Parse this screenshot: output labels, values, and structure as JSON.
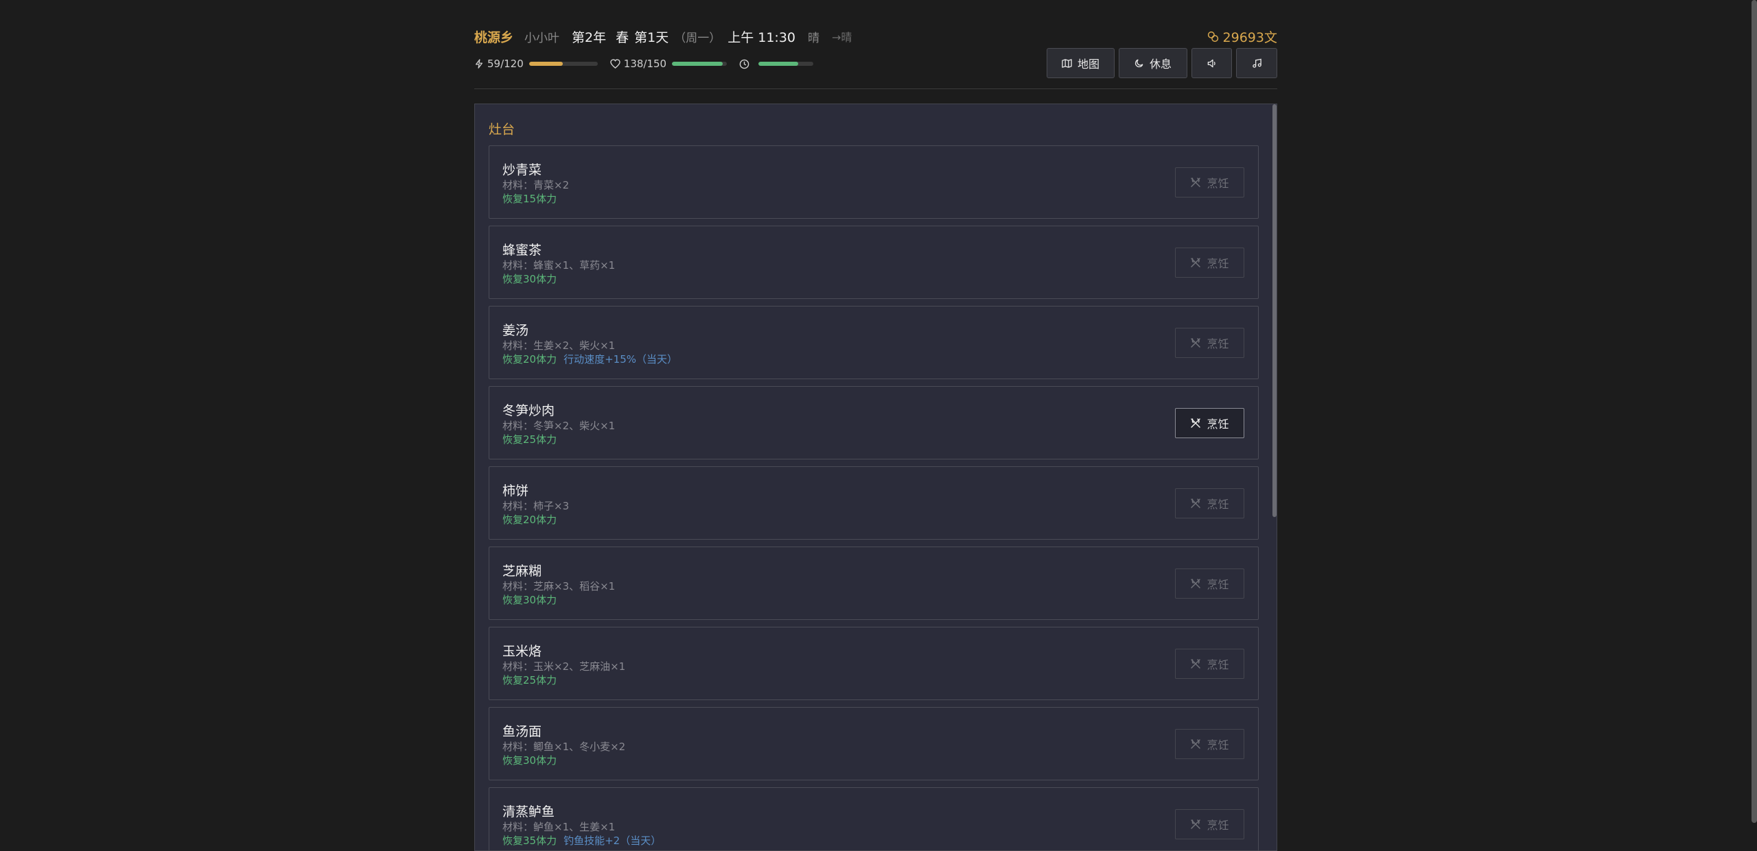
{
  "header": {
    "location": "桃源乡",
    "sub_location": "小小叶",
    "year": "第2年",
    "season": "春",
    "day": "第1天",
    "weekday": "（周一）",
    "time": "上午 11:30",
    "weather": "晴",
    "forecast": "→晴",
    "money": "29693文"
  },
  "stats": {
    "stamina": {
      "label": "59/120",
      "fraction": 0.4917,
      "color": "#d9a84e"
    },
    "health": {
      "label": "138/150",
      "fraction": 0.92,
      "color": "#5cb87a"
    },
    "time_progress": {
      "fraction": 0.72,
      "color": "#5cb87a"
    }
  },
  "toolbar": {
    "map_label": "地图",
    "rest_label": "休息"
  },
  "panel": {
    "title": "灶台",
    "cook_label": "烹饪",
    "recipes": [
      {
        "name": "炒青菜",
        "materials": "材料：青菜×2",
        "restore": "恢复15体力",
        "bonus": "",
        "enabled": false
      },
      {
        "name": "蜂蜜茶",
        "materials": "材料：蜂蜜×1、草药×1",
        "restore": "恢复30体力",
        "bonus": "",
        "enabled": false
      },
      {
        "name": "姜汤",
        "materials": "材料：生姜×2、柴火×1",
        "restore": "恢复20体力",
        "bonus": "行动速度+15%（当天）",
        "enabled": false
      },
      {
        "name": "冬笋炒肉",
        "materials": "材料：冬笋×2、柴火×1",
        "restore": "恢复25体力",
        "bonus": "",
        "enabled": true
      },
      {
        "name": "柿饼",
        "materials": "材料：柿子×3",
        "restore": "恢复20体力",
        "bonus": "",
        "enabled": false
      },
      {
        "name": "芝麻糊",
        "materials": "材料：芝麻×3、稻谷×1",
        "restore": "恢复30体力",
        "bonus": "",
        "enabled": false
      },
      {
        "name": "玉米烙",
        "materials": "材料：玉米×2、芝麻油×1",
        "restore": "恢复25体力",
        "bonus": "",
        "enabled": false
      },
      {
        "name": "鱼汤面",
        "materials": "材料：鲫鱼×1、冬小麦×2",
        "restore": "恢复30体力",
        "bonus": "",
        "enabled": false
      },
      {
        "name": "清蒸鲈鱼",
        "materials": "材料：鲈鱼×1、生姜×1",
        "restore": "恢复35体力",
        "bonus": "钓鱼技能+2（当天）",
        "enabled": false
      }
    ]
  },
  "icons": {
    "stamina": "lightning-icon",
    "health": "heart-icon",
    "clock": "clock-icon",
    "money": "coin-icon",
    "map": "map-icon",
    "rest": "moon-icon",
    "sound": "speaker-icon",
    "music": "music-note-icon",
    "cook": "utensils-icon"
  }
}
